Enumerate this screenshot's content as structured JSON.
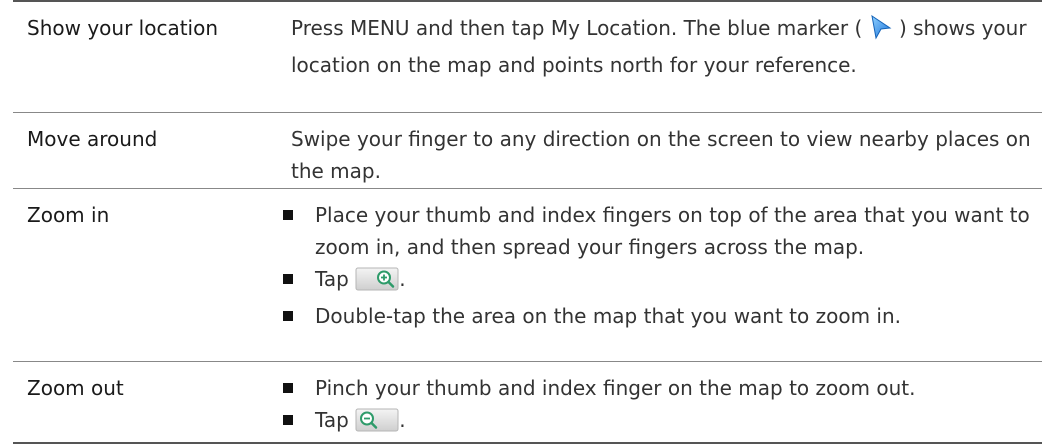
{
  "rows": [
    {
      "term": "Show your location",
      "desc_before": "Press MENU and then tap My Location. The blue marker (",
      "icon": "blue-location-marker-icon",
      "desc_after": ") shows your location on the map and points north for your reference."
    },
    {
      "term": "Move around",
      "desc": "Swipe your finger to any direction on the screen to view nearby places on the map."
    },
    {
      "term": "Zoom in",
      "items": [
        {
          "text": "Place your thumb and index fingers on top of the area that you want to zoom in, and then spread your fingers across the map."
        },
        {
          "prefix": "Tap",
          "icon": "zoom-in-button-icon",
          "suffix": "."
        },
        {
          "text": "Double-tap the area on the map that you want to zoom in."
        }
      ]
    },
    {
      "term": "Zoom out",
      "items": [
        {
          "text": "Pinch your thumb and index finger on the map to zoom out."
        },
        {
          "prefix": "Tap",
          "icon": "zoom-out-button-icon",
          "suffix": "."
        }
      ]
    }
  ],
  "colors": {
    "marker_blue": "#3399ee",
    "zoom_icon_green": "#2e9b6a",
    "rule": "#888888"
  }
}
